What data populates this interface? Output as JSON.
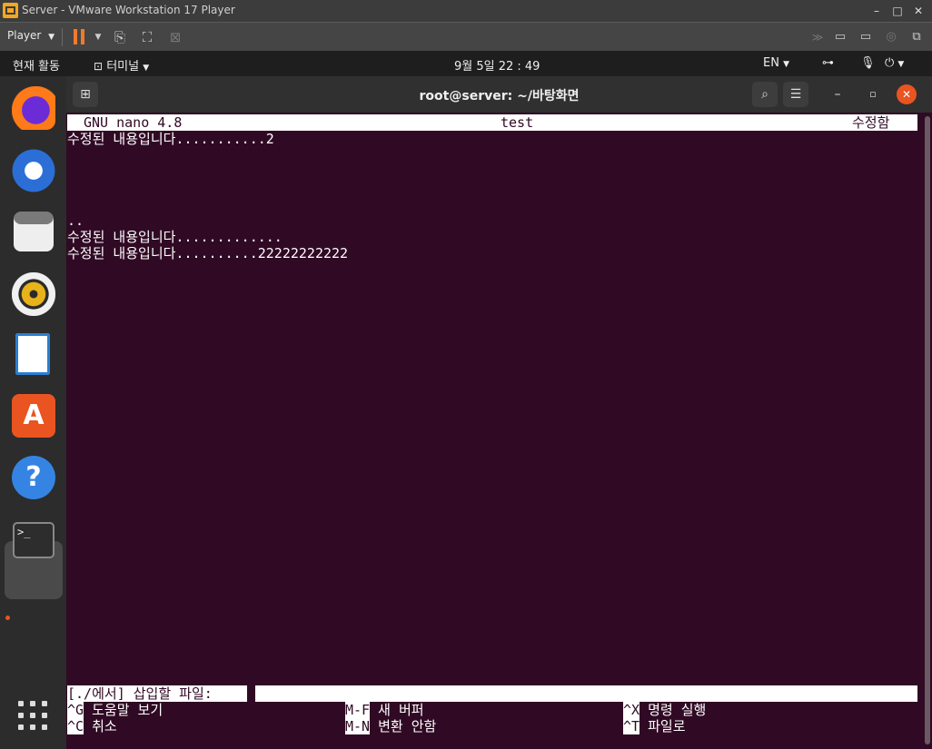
{
  "vmware": {
    "title": "Server - VMware Workstation 17 Player",
    "player_menu": "Player",
    "win_min": "–",
    "win_max": "□",
    "win_close": "✕"
  },
  "topbar": {
    "activities": "현재 활동",
    "app_menu": "터미널",
    "clock": "9월 5일  22 : 49",
    "lang": "EN"
  },
  "dock": {
    "items": [
      "firefox",
      "thunderbird",
      "files",
      "rhythmbox",
      "libreoffice-writer",
      "software",
      "help",
      "terminal"
    ]
  },
  "terminal": {
    "title": "root@server: ~/바탕화면"
  },
  "nano": {
    "version": "GNU nano 4.8",
    "filename": "test",
    "status": "수정함",
    "lines": [
      "수정된 내용입니다...........2",
      "",
      "",
      "",
      "",
      "..",
      "수정된 내용입니다.............",
      "수정된 내용입니다..........22222222222"
    ],
    "prompt": "[./에서] 삽입할 파일:",
    "shortcuts": [
      {
        "key": "^G",
        "label": "도움말 보기"
      },
      {
        "key": "M-F",
        "label": "새 버퍼"
      },
      {
        "key": "^X",
        "label": "명령 실행"
      },
      {
        "key": "^C",
        "label": "취소"
      },
      {
        "key": "M-N",
        "label": "변환 안함"
      },
      {
        "key": "^T",
        "label": "파일로"
      }
    ]
  },
  "colors": {
    "terminal_bg": "#300a24",
    "accent": "#e95420"
  }
}
